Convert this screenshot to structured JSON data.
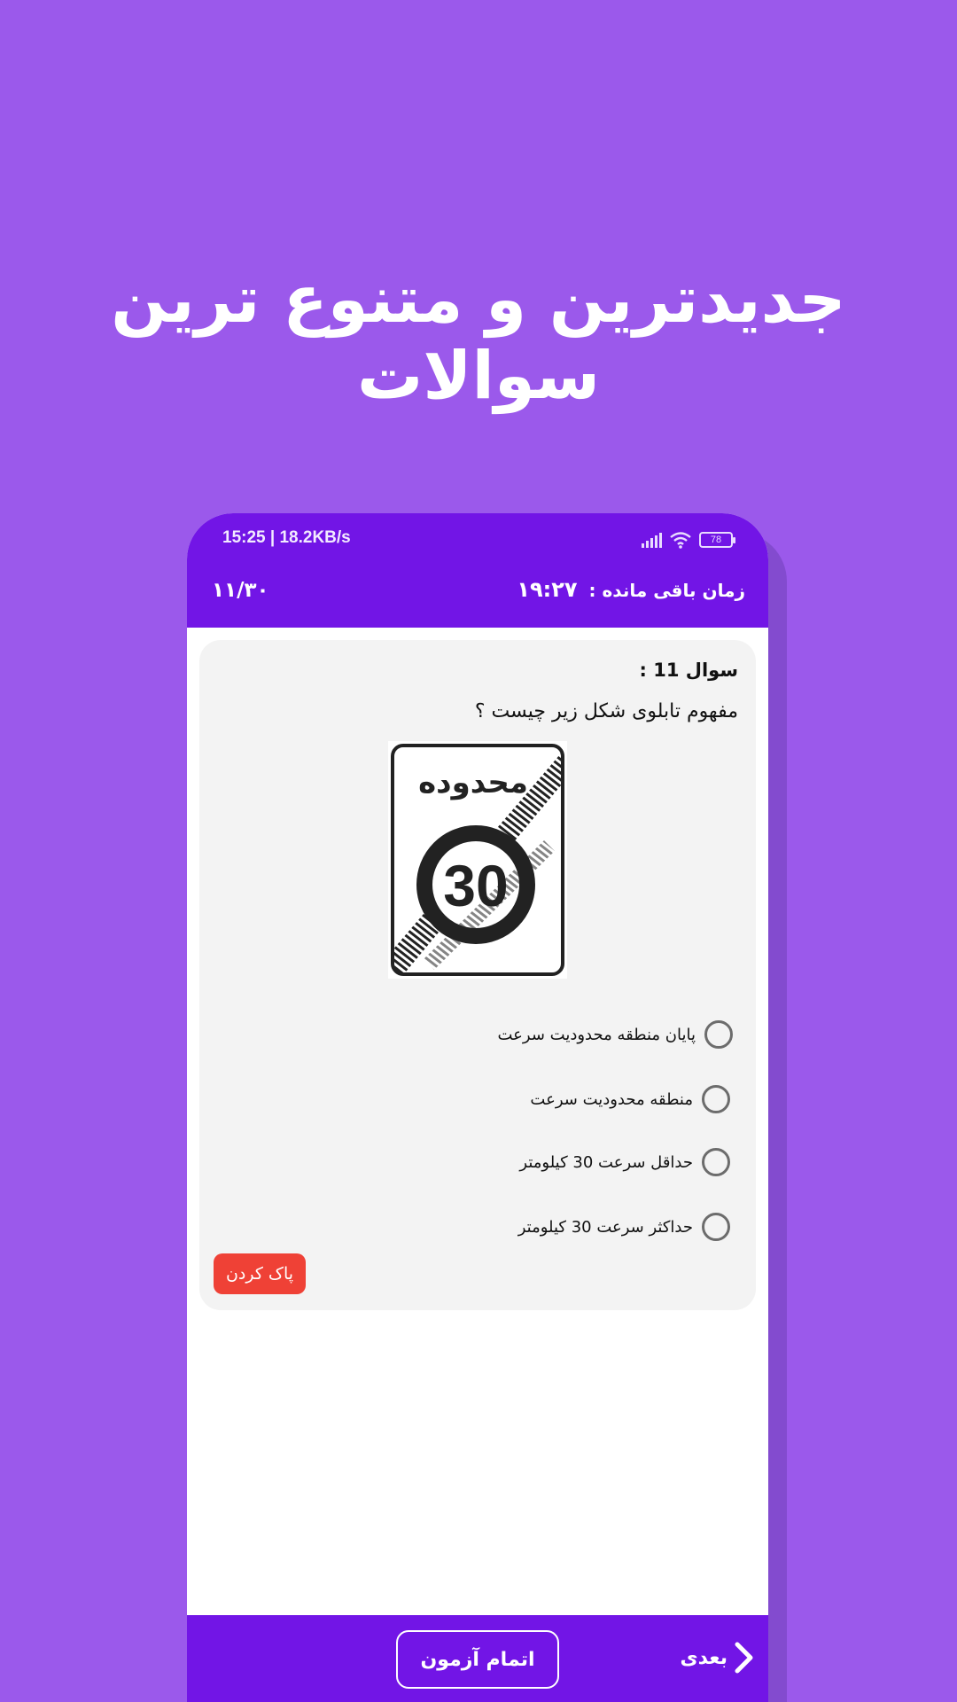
{
  "headline": "جدیدترین و متنوع ترین سوالات",
  "status_bar": {
    "time_speed": "15:25 | 18.2KB/s",
    "battery": "78"
  },
  "exam_header": {
    "counter": "۱۱/۳۰",
    "timer_label": "زمان باقی مانده :",
    "timer_value": "۱۹:۲۷"
  },
  "question": {
    "title": "سوال 11 :",
    "text": "مفهوم تابلوی شکل زیر چیست ؟",
    "sign": {
      "top_text": "محدوده",
      "number": "30"
    },
    "options": [
      "پایان منطقه محدودیت سرعت",
      "منطقه محدودیت سرعت",
      "حداقل سرعت 30 کیلومتر",
      "حداکثر سرعت 30 کیلومتر"
    ],
    "clear_label": "پاک کردن"
  },
  "footer": {
    "finish_label": "اتمام آزمون",
    "next_label": "بعدی"
  },
  "colors": {
    "background": "#9b59eb",
    "primary": "#7215e6",
    "danger": "#ef4136"
  }
}
